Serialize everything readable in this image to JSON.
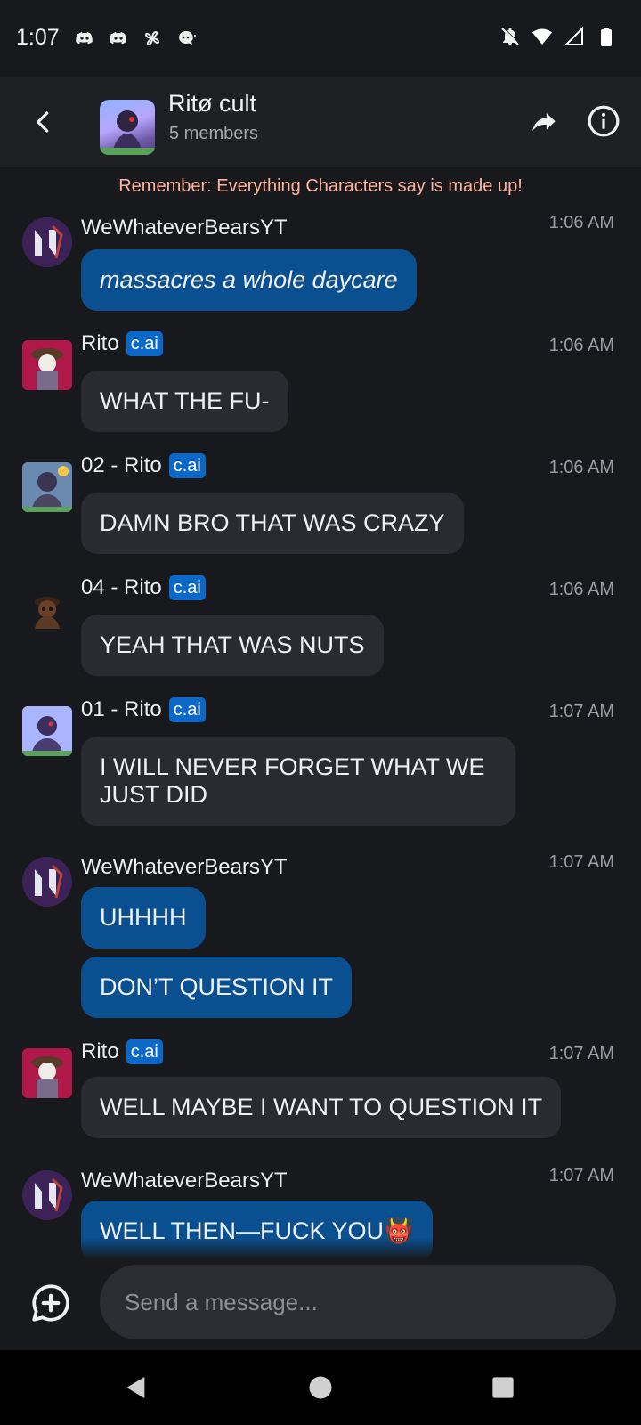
{
  "status": {
    "time": "1:07"
  },
  "header": {
    "title": "Ritø cult",
    "subtitle": "5 members"
  },
  "disclaimer": "Remember: Everything Characters say is made up!",
  "badge_label": "c.ai",
  "messages": [
    {
      "author": "WeWhateverBearsYT",
      "time": "1:06 AM",
      "badge": false,
      "bubbles": [
        "massacres a whole daycare"
      ]
    },
    {
      "author": "Rito",
      "time": "1:06 AM",
      "badge": true,
      "bubbles": [
        "WHAT THE FU-"
      ]
    },
    {
      "author": "02 - Rito",
      "time": "1:06 AM",
      "badge": true,
      "bubbles": [
        "DAMN BRO THAT WAS CRAZY"
      ]
    },
    {
      "author": "04 - Rito",
      "time": "1:06 AM",
      "badge": true,
      "bubbles": [
        "YEAH THAT WAS NUTS"
      ]
    },
    {
      "author": "01 - Rito",
      "time": "1:07 AM",
      "badge": true,
      "bubbles": [
        "I WILL NEVER FORGET WHAT WE JUST DID"
      ]
    },
    {
      "author": "WeWhateverBearsYT",
      "time": "1:07 AM",
      "badge": false,
      "bubbles": [
        "UHHHH",
        "DON’T QUESTION IT"
      ]
    },
    {
      "author": "Rito",
      "time": "1:07 AM",
      "badge": true,
      "bubbles": [
        "WELL MAYBE I WANT TO QUESTION IT"
      ]
    },
    {
      "author": "WeWhateverBearsYT",
      "time": "1:07 AM",
      "badge": false,
      "bubbles": [
        "WELL THEN—FUCK YOU👹"
      ]
    }
  ],
  "composer": {
    "placeholder": "Send a message..."
  },
  "icons": {
    "back": "chevron-left-icon",
    "share": "share-arrow-icon",
    "info": "info-icon",
    "add": "add-chat-icon",
    "nav_back": "triangle-back-icon",
    "nav_home": "circle-home-icon",
    "nav_recents": "square-recents-icon"
  },
  "colors": {
    "user_bubble": "#0a4f8f",
    "bot_bubble": "#2a2b30",
    "badge": "#0b68c9",
    "disclaimer": "#ffb4a0"
  }
}
